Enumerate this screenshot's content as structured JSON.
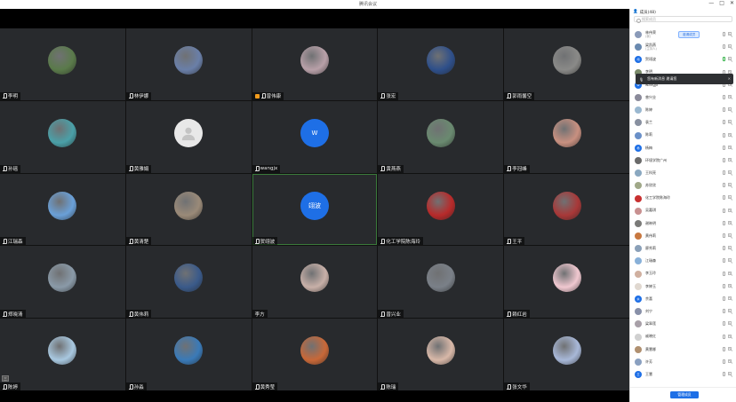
{
  "window": {
    "title": "腾讯会议",
    "controls": [
      "—",
      "□",
      "✕"
    ]
  },
  "tiles": [
    {
      "name": "李明",
      "avatar": "photo",
      "color": "#5a7a4a",
      "host": false
    },
    {
      "name": "林伊娜",
      "avatar": "photo",
      "color": "#6a7fa8",
      "host": false
    },
    {
      "name": "曾伟康",
      "avatar": "photo",
      "color": "#b8a0a8",
      "host": true
    },
    {
      "name": "张宏",
      "avatar": "photo",
      "color": "#2e4f8a",
      "host": false
    },
    {
      "name": "郭雨馨空",
      "avatar": "photo",
      "color": "#8a8a88",
      "host": false
    },
    {
      "name": "孙瑶",
      "avatar": "photo",
      "color": "#4aa0a8",
      "host": false
    },
    {
      "name": "黄雅娟",
      "avatar": "placeholder",
      "color": "#e8e8e8",
      "host": false
    },
    {
      "name": "wangjx",
      "avatar": "letter",
      "letter": "W",
      "color": "#1e6fe6",
      "host": false
    },
    {
      "name": "黄燕燕",
      "avatar": "photo",
      "color": "#6a8a70",
      "host": false
    },
    {
      "name": "李冠峰",
      "avatar": "photo",
      "color": "#c89080",
      "host": false
    },
    {
      "name": "江瑞森",
      "avatar": "photo",
      "color": "#6aa0d8",
      "host": false
    },
    {
      "name": "黄清楚",
      "avatar": "photo",
      "color": "#9a8a78",
      "host": false
    },
    {
      "name": "贺翊波",
      "avatar": "letter",
      "letter": "翊波",
      "color": "#1e6fe6",
      "host": false,
      "active": true
    },
    {
      "name": "化工学院陈海玲",
      "avatar": "photo",
      "color": "#b82a2a",
      "host": false
    },
    {
      "name": "王平",
      "avatar": "photo",
      "color": "#a83838",
      "host": false
    },
    {
      "name": "郑晓清",
      "avatar": "photo",
      "color": "#8a9aa8",
      "host": false
    },
    {
      "name": "黄伟莉",
      "avatar": "photo",
      "color": "#3a5a8a",
      "host": false
    },
    {
      "name": "李方",
      "avatar": "photo",
      "color": "#c8b0a8",
      "host": false,
      "nomic": true
    },
    {
      "name": "曾兴业",
      "avatar": "photo",
      "color": "#7a8088",
      "host": false
    },
    {
      "name": "赖红岩",
      "avatar": "photo",
      "color": "#f0c8d0",
      "host": false
    },
    {
      "name": "陈婷",
      "avatar": "photo",
      "color": "#a8c8e0",
      "host": false,
      "corner": "三"
    },
    {
      "name": "孙淼",
      "avatar": "photo",
      "color": "#3a7ab8",
      "host": false
    },
    {
      "name": "黄秀莹",
      "avatar": "photo",
      "color": "#c86838",
      "host": false
    },
    {
      "name": "陈瑞",
      "avatar": "photo",
      "color": "#d8b8a8",
      "host": false
    },
    {
      "name": "张文华",
      "avatar": "photo",
      "color": "#a8b8d8",
      "host": false
    }
  ],
  "panel": {
    "title": "成员(48)",
    "search_placeholder": "搜索成员",
    "invite_label": "邀请成员",
    "popup_text": "您有新消息  邀请您",
    "popup_close": "✕",
    "manage_label": "管理成员",
    "members": [
      {
        "name": "林伟荣",
        "sub": "(我)",
        "color": "#8a9ab8",
        "mic": "off"
      },
      {
        "name": "梁凯燕",
        "sub": "(主持人)",
        "color": "#6a8ab0",
        "mic": "off"
      },
      {
        "name": "贺翊波",
        "sub": "",
        "color": "#1e6fe6",
        "mic": "on",
        "letter": "翊"
      },
      {
        "name": "李明",
        "sub": "",
        "color": "#7a8a6a",
        "mic": "off"
      },
      {
        "name": "wangjx",
        "sub": "",
        "color": "#1e6fe6",
        "mic": "off",
        "letter": "W"
      },
      {
        "name": "曾兴业",
        "sub": "",
        "color": "#8a8a9a",
        "mic": "off"
      },
      {
        "name": "陈婷",
        "sub": "",
        "color": "#9ab8d0",
        "mic": "off"
      },
      {
        "name": "袁兰",
        "sub": "",
        "color": "#8890a0",
        "mic": "off"
      },
      {
        "name": "陈莉",
        "sub": "",
        "color": "#6a90c8",
        "mic": "off"
      },
      {
        "name": "杨梅",
        "sub": "",
        "color": "#1e6fe6",
        "mic": "off",
        "letter": "杨"
      },
      {
        "name": "环境学院广州",
        "sub": "",
        "color": "#6a6a6a",
        "mic": "off"
      },
      {
        "name": "王科亮",
        "sub": "",
        "color": "#8aa8c0",
        "mic": "off"
      },
      {
        "name": "苏欣欣",
        "sub": "",
        "color": "#a0a888",
        "mic": "off"
      },
      {
        "name": "化工学院陈海玲",
        "sub": "",
        "color": "#c83030",
        "mic": "off"
      },
      {
        "name": "吴嘉琪",
        "sub": "",
        "color": "#c89090",
        "mic": "off"
      },
      {
        "name": "谢映明",
        "sub": "",
        "color": "#7a7a78",
        "mic": "off"
      },
      {
        "name": "黄伟莉",
        "sub": "",
        "color": "#c87840",
        "mic": "off"
      },
      {
        "name": "廖秀莉",
        "sub": "",
        "color": "#8aa0b8",
        "mic": "off"
      },
      {
        "name": "江瑞森",
        "sub": "",
        "color": "#88b0d8",
        "mic": "off"
      },
      {
        "name": "李玉玲",
        "sub": "",
        "color": "#d0b0a0",
        "mic": "off"
      },
      {
        "name": "李婷玉",
        "sub": "",
        "color": "#e0d8d0",
        "mic": "off"
      },
      {
        "name": "余喜",
        "sub": "",
        "color": "#1e6fe6",
        "mic": "off",
        "letter": "余"
      },
      {
        "name": "刘宁",
        "sub": "",
        "color": "#8890a8",
        "mic": "off"
      },
      {
        "name": "梁翠莲",
        "sub": "",
        "color": "#a8a0a8",
        "mic": "off"
      },
      {
        "name": "戚晓红",
        "sub": "",
        "color": "#d0d0d0",
        "mic": "off"
      },
      {
        "name": "黄慧娜",
        "sub": "",
        "color": "#b09070",
        "mic": "off"
      },
      {
        "name": "许芳",
        "sub": "",
        "color": "#8aa0c0",
        "mic": "off"
      },
      {
        "name": "王慧",
        "sub": "",
        "color": "#1e6fe6",
        "mic": "off",
        "letter": "王"
      }
    ]
  }
}
